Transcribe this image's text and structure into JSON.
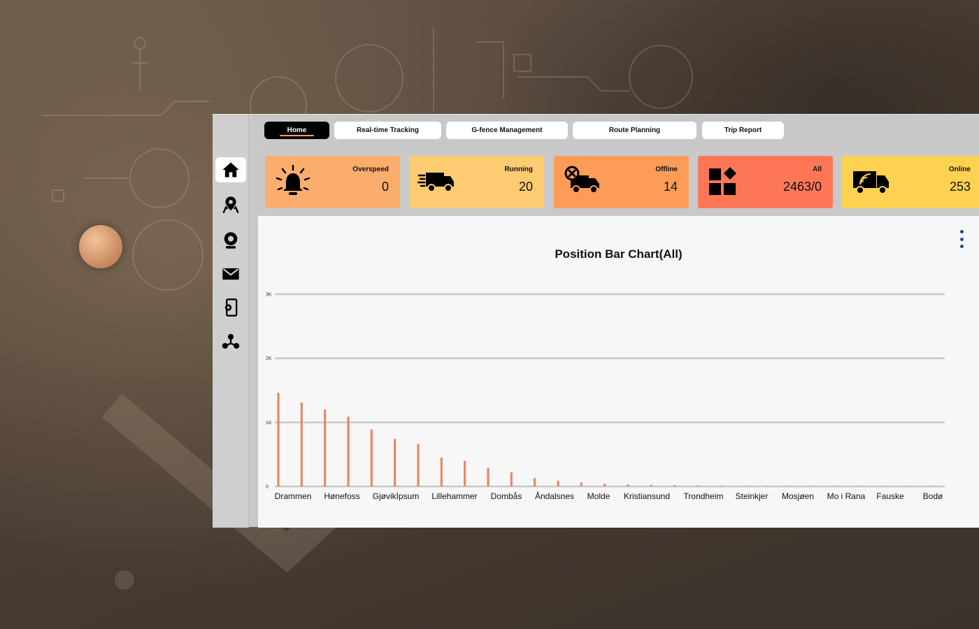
{
  "tabs": [
    {
      "label": "Home",
      "active": true
    },
    {
      "label": "Real-time Tracking",
      "active": false
    },
    {
      "label": "G-fence Management",
      "active": false
    },
    {
      "label": "Route Planning",
      "active": false
    },
    {
      "label": "Trip Report",
      "active": false
    }
  ],
  "sidebar": {
    "items": [
      {
        "icon": "home-icon",
        "active": true
      },
      {
        "icon": "map-pin-icon",
        "active": false
      },
      {
        "icon": "webcam-icon",
        "active": false
      },
      {
        "icon": "mail-icon",
        "active": false
      },
      {
        "icon": "mobile-settings-icon",
        "active": false
      },
      {
        "icon": "network-icon",
        "active": false
      }
    ]
  },
  "cards": [
    {
      "label": "Overspeed",
      "value": "0",
      "icon": "alarm-bell-icon",
      "color": "#fbad6e"
    },
    {
      "label": "Running",
      "value": "20",
      "icon": "speeding-truck-icon",
      "color": "#fdcb72"
    },
    {
      "label": "Offline",
      "value": "14",
      "icon": "truck-offline-icon",
      "color": "#fd9c59"
    },
    {
      "label": "All",
      "value": "2463/0",
      "icon": "apps-grid-icon",
      "color": "#fd7757"
    },
    {
      "label": "Online",
      "value": "253",
      "icon": "truck-wifi-icon",
      "color": "#fed250"
    }
  ],
  "chart_data": {
    "type": "bar",
    "title": "Position Bar Chart(All)",
    "xlabel": "",
    "ylabel": "",
    "ylim": [
      0,
      3000
    ],
    "yticks": [
      "0",
      "1K",
      "2K",
      "3K"
    ],
    "grid": true,
    "bar_color": "#f07f5f",
    "categories": [
      "Drammen",
      "Hønefoss",
      "Gjøvikİpsum",
      "Lillehammer",
      "Dombås",
      "Åndalsnes",
      "Molde",
      "Kristiansund",
      "Trondheim",
      "Steinkjer",
      "Mosjøen",
      "Mo i Rana",
      "Fauske",
      "Bodø"
    ],
    "values": [
      1460,
      1310,
      1200,
      1090,
      890,
      740,
      660,
      450,
      400,
      290,
      220,
      130,
      90,
      60,
      40,
      30,
      25,
      20,
      15,
      12,
      10,
      8,
      7,
      6,
      5,
      4,
      3,
      2,
      2
    ]
  }
}
